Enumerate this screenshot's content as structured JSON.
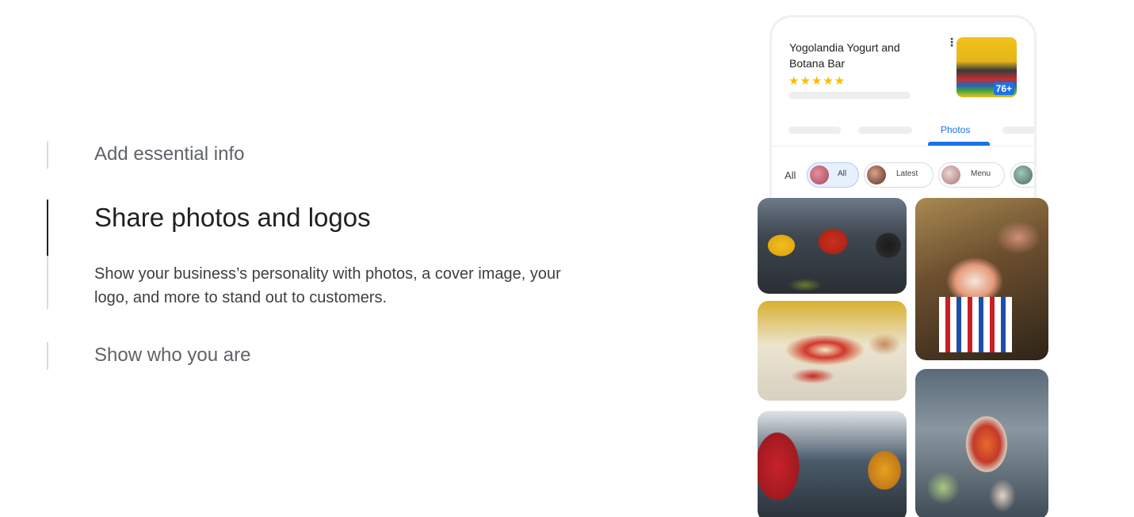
{
  "accordion": {
    "items": [
      {
        "title": "Add essential info"
      },
      {
        "title": "Share photos and logos",
        "description": "Show your business’s personality with photos, a cover image, your logo, and more to stand out to customers."
      },
      {
        "title": "Show who you are"
      }
    ]
  },
  "phone": {
    "business_name": "Yogolandia Yogurt and Botana Bar",
    "rating_stars": "★★★★★",
    "more_icon": "⋮",
    "thumb_count": "76+",
    "active_tab": "Photos",
    "chips_label": "All",
    "chips": [
      {
        "label": "All"
      },
      {
        "label": "Latest"
      },
      {
        "label": "Menu"
      }
    ]
  },
  "colors": {
    "accent": "#1a73e8",
    "star": "#fbbc04",
    "active_bar": "#202124",
    "inactive_bar": "#dadce0"
  }
}
